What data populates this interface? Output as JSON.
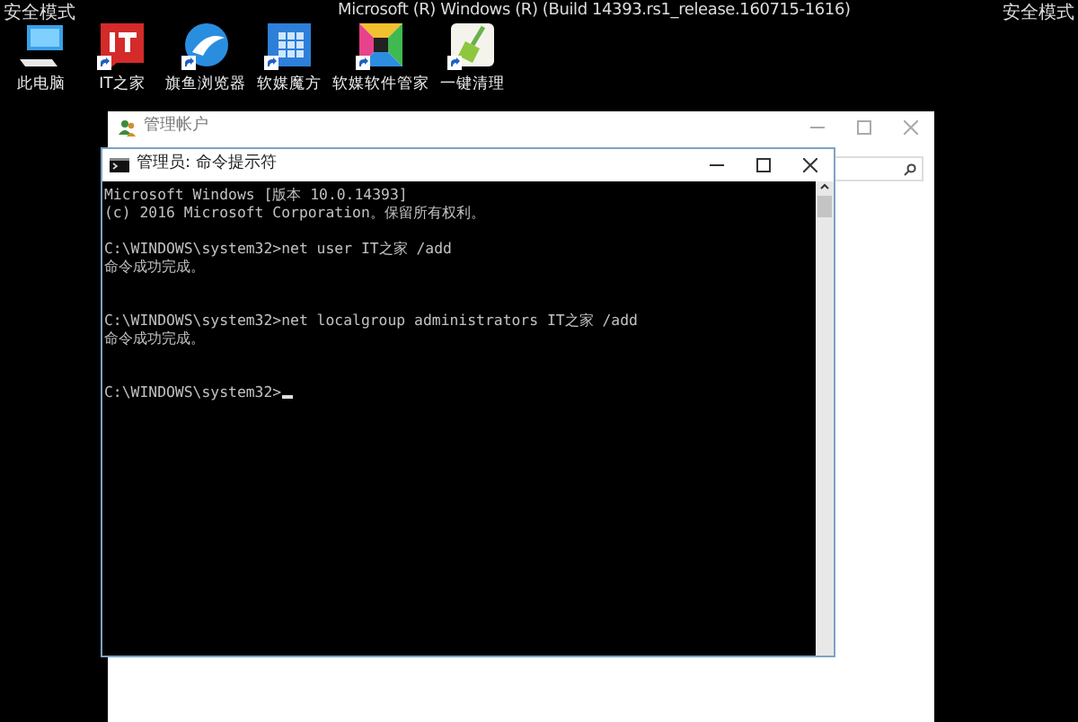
{
  "top_bar": {
    "left_label": "安全模式",
    "build_info": "Microsoft (R) Windows (R) (Build 14393.rs1_release.160715-1616)",
    "right_label": "安全模式"
  },
  "desktop_icons": [
    {
      "label": "此电脑",
      "kind": "computer",
      "shortcut": false
    },
    {
      "label": "IT之家",
      "kind": "ithome",
      "shortcut": true
    },
    {
      "label": "旗鱼浏览器",
      "kind": "browser",
      "shortcut": true
    },
    {
      "label": "软媒魔方",
      "kind": "cube",
      "shortcut": true
    },
    {
      "label": "软媒软件管家",
      "kind": "manager",
      "shortcut": true
    },
    {
      "label": "一键清理",
      "kind": "cleaner",
      "shortcut": true
    }
  ],
  "back_window": {
    "title": "管理帐户"
  },
  "console_window": {
    "title": "管理员: 命令提示符",
    "lines": [
      {
        "kind": "output",
        "text": "Microsoft Windows [版本 10.0.14393]"
      },
      {
        "kind": "output",
        "text": "(c) 2016 Microsoft Corporation。保留所有权利。"
      },
      {
        "kind": "blank"
      },
      {
        "kind": "output",
        "text": "C:\\WINDOWS\\system32>net user IT之家 /add"
      },
      {
        "kind": "output",
        "text": "命令成功完成。"
      },
      {
        "kind": "blank"
      },
      {
        "kind": "blank"
      },
      {
        "kind": "output",
        "text": "C:\\WINDOWS\\system32>net localgroup administrators IT之家 /add"
      },
      {
        "kind": "output",
        "text": "命令成功完成。"
      },
      {
        "kind": "blank"
      },
      {
        "kind": "blank"
      },
      {
        "kind": "input",
        "text": "C:\\WINDOWS\\system32>"
      }
    ]
  }
}
